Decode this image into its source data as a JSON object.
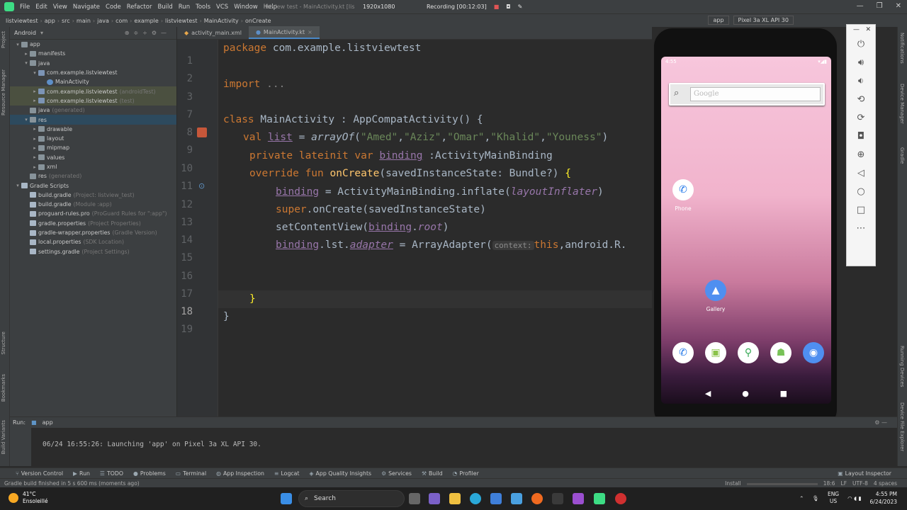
{
  "menubar": {
    "items": [
      "File",
      "Edit",
      "View",
      "Navigate",
      "Code",
      "Refactor",
      "Build",
      "Run",
      "Tools",
      "VCS",
      "Window",
      "Help"
    ],
    "window_title": "listview test - MainActivity.kt [lis",
    "resolution": "1920x1080",
    "recording": "Recording [00:12:03]"
  },
  "navbar": {
    "crumbs": [
      "listviewtest",
      "app",
      "src",
      "main",
      "java",
      "com",
      "example",
      "listviewtest",
      "MainActivity",
      "onCreate"
    ],
    "run_config": "app",
    "device": "Pixel 3a XL API 30"
  },
  "left_strip": {
    "project": "Project",
    "resource_manager": "Resource Manager",
    "structure": "Structure",
    "bookmarks": "Bookmarks",
    "build_variants": "Build Variants"
  },
  "right_strip": {
    "notifications": "Notifications",
    "device_manager": "Device Manager",
    "gradle": "Gradle",
    "running_devices": "Running Devices",
    "device_file_explorer": "Device File Explorer"
  },
  "project": {
    "view": "Android",
    "tree": [
      {
        "label": "app",
        "extra": "",
        "indent": 0,
        "arrow": "▾",
        "icon": "folder"
      },
      {
        "label": "manifests",
        "extra": "",
        "indent": 1,
        "arrow": "▸",
        "icon": "folder"
      },
      {
        "label": "java",
        "extra": "",
        "indent": 1,
        "arrow": "▾",
        "icon": "folder"
      },
      {
        "label": "com.example.listviewtest",
        "extra": "",
        "indent": 2,
        "arrow": "▾",
        "icon": "pkg"
      },
      {
        "label": "MainActivity",
        "extra": "",
        "indent": 3,
        "arrow": "",
        "icon": "kt"
      },
      {
        "label": "com.example.listviewtest",
        "extra": "(androidTest)",
        "indent": 2,
        "arrow": "▸",
        "icon": "pkg"
      },
      {
        "label": "com.example.listviewtest",
        "extra": "(test)",
        "indent": 2,
        "arrow": "▸",
        "icon": "pkg"
      },
      {
        "label": "java",
        "extra": "(generated)",
        "indent": 1,
        "arrow": "",
        "icon": "folder"
      },
      {
        "label": "res",
        "extra": "",
        "indent": 1,
        "arrow": "▾",
        "icon": "folder"
      },
      {
        "label": "drawable",
        "extra": "",
        "indent": 2,
        "arrow": "▸",
        "icon": "folder"
      },
      {
        "label": "layout",
        "extra": "",
        "indent": 2,
        "arrow": "▸",
        "icon": "folder"
      },
      {
        "label": "mipmap",
        "extra": "",
        "indent": 2,
        "arrow": "▸",
        "icon": "folder"
      },
      {
        "label": "values",
        "extra": "",
        "indent": 2,
        "arrow": "▸",
        "icon": "folder"
      },
      {
        "label": "xml",
        "extra": "",
        "indent": 2,
        "arrow": "▸",
        "icon": "folder"
      },
      {
        "label": "res",
        "extra": "(generated)",
        "indent": 1,
        "arrow": "",
        "icon": "folder"
      },
      {
        "label": "Gradle Scripts",
        "extra": "",
        "indent": 0,
        "arrow": "▾",
        "icon": "file"
      },
      {
        "label": "build.gradle",
        "extra": "(Project: listview_test)",
        "indent": 1,
        "arrow": "",
        "icon": "file"
      },
      {
        "label": "build.gradle",
        "extra": "(Module :app)",
        "indent": 1,
        "arrow": "",
        "icon": "file"
      },
      {
        "label": "proguard-rules.pro",
        "extra": "(ProGuard Rules for \":app\")",
        "indent": 1,
        "arrow": "",
        "icon": "file"
      },
      {
        "label": "gradle.properties",
        "extra": "(Project Properties)",
        "indent": 1,
        "arrow": "",
        "icon": "file"
      },
      {
        "label": "gradle-wrapper.properties",
        "extra": "(Gradle Version)",
        "indent": 1,
        "arrow": "",
        "icon": "file"
      },
      {
        "label": "local.properties",
        "extra": "(SDK Location)",
        "indent": 1,
        "arrow": "",
        "icon": "file"
      },
      {
        "label": "settings.gradle",
        "extra": "(Project Settings)",
        "indent": 1,
        "arrow": "",
        "icon": "file"
      }
    ]
  },
  "editor": {
    "tabs": [
      "activity_main.xml",
      "MainActivity.kt"
    ],
    "lines": [
      "1",
      "2",
      "3",
      "7",
      "8",
      "9",
      "10",
      "11",
      "12",
      "13",
      "14",
      "15",
      "16",
      "17",
      "18",
      "19"
    ],
    "code": {
      "l1_kw": "package",
      "l1_rest": " com.example.listviewtest",
      "l3_kw": "import",
      "l3_rest": " ...",
      "l8_kw": "class",
      "l8_rest": " MainActivity : AppCompatActivity() {",
      "l9_kw": "val",
      "l9_var": "list",
      "l9_eq": " = ",
      "l9_fn": "arrayOf",
      "l9_open": "(",
      "l9_s1": "\"Amed\"",
      "l9_s2": "\"Aziz\"",
      "l9_s3": "\"Omar\"",
      "l9_s4": "\"Khalid\"",
      "l9_s5": "\"Youness\"",
      "l9_close": ")",
      "l10_kw": "private lateinit var",
      "l10_var": "binding",
      "l10_rest": " :ActivityMainBinding",
      "l11_kw": "override fun",
      "l11_fn": "onCreate",
      "l11_rest": "(savedInstanceState: Bundle?) ",
      "l11_brace": "{",
      "l12_var": "binding",
      "l12_rest": " = ActivityMainBinding.inflate(",
      "l12_it": "layoutInflater",
      "l12_close": ")",
      "l13_kw": "super",
      "l13_rest": ".onCreate(savedInstanceState)",
      "l14_rest": "setContentView(",
      "l14_var": "binding",
      "l14_dot": ".",
      "l14_it": "root",
      "l14_close": ")",
      "l15_var": "binding",
      "l15_mid": ".lst.",
      "l15_it": "adapter",
      "l15_rest": " = ArrayAdapter(",
      "l15_hint": "context:",
      "l15_kw": "this",
      "l15_tail": ",android.R.",
      "l18_brace": "}",
      "l19_brace": "}"
    }
  },
  "emulator": {
    "status_time": "4:55",
    "search_placeholder": "Google",
    "apps": [
      {
        "label": "Phone"
      },
      {
        "label": "Gallery"
      }
    ]
  },
  "run": {
    "label": "Run:",
    "config": "app",
    "log": "06/24 16:55:26: Launching 'app' on Pixel 3a XL API 30."
  },
  "toolwindows": [
    "Version Control",
    "Run",
    "TODO",
    "Problems",
    "Terminal",
    "App Inspection",
    "Logcat",
    "App Quality Insights",
    "Services",
    "Build",
    "Profiler"
  ],
  "layout_inspector": "Layout Inspector",
  "statusbar": {
    "message": "Gradle build finished in 5 s 600 ms (moments ago)",
    "install": "Install",
    "position": "18:6",
    "line_sep": "LF",
    "encoding": "UTF-8",
    "indent": "4 spaces"
  },
  "taskbar": {
    "temp": "41°C",
    "weather": "Ensoleillé",
    "search": "Search",
    "lang": "ENG",
    "region": "US",
    "time": "4:55 PM",
    "date": "6/24/2023"
  }
}
